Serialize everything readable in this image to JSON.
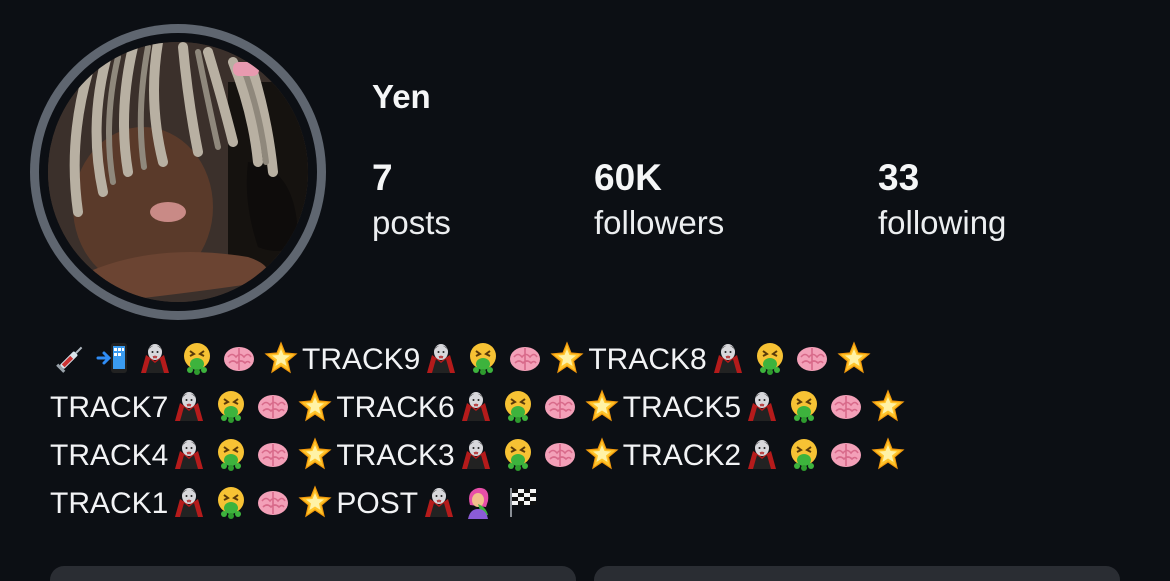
{
  "profile": {
    "username": "Yen",
    "stats": {
      "posts": {
        "value": "7",
        "label": "posts"
      },
      "followers": {
        "value": "60K",
        "label": "followers"
      },
      "following": {
        "value": "33",
        "label": "following"
      }
    }
  },
  "bio": {
    "lines": [
      [
        {
          "t": "e",
          "icon": "syringe-icon"
        },
        {
          "t": "e",
          "icon": "phone-arrow-icon"
        },
        {
          "t": "e",
          "icon": "vampire-icon"
        },
        {
          "t": "e",
          "icon": "vomit-face-icon"
        },
        {
          "t": "e",
          "icon": "brain-icon"
        },
        {
          "t": "e",
          "icon": "star-icon"
        },
        {
          "t": "x",
          "text": "TRACK9"
        },
        {
          "t": "e",
          "icon": "vampire-icon"
        },
        {
          "t": "e",
          "icon": "vomit-face-icon"
        },
        {
          "t": "e",
          "icon": "brain-icon"
        },
        {
          "t": "e",
          "icon": "star-icon"
        },
        {
          "t": "x",
          "text": "TRACK8"
        },
        {
          "t": "e",
          "icon": "vampire-icon"
        },
        {
          "t": "e",
          "icon": "vomit-face-icon"
        },
        {
          "t": "e",
          "icon": "brain-icon"
        },
        {
          "t": "e",
          "icon": "star-icon"
        }
      ],
      [
        {
          "t": "x",
          "text": "TRACK7"
        },
        {
          "t": "e",
          "icon": "vampire-icon"
        },
        {
          "t": "e",
          "icon": "vomit-face-icon"
        },
        {
          "t": "e",
          "icon": "brain-icon"
        },
        {
          "t": "e",
          "icon": "star-icon"
        },
        {
          "t": "x",
          "text": "TRACK6"
        },
        {
          "t": "e",
          "icon": "vampire-icon"
        },
        {
          "t": "e",
          "icon": "vomit-face-icon"
        },
        {
          "t": "e",
          "icon": "brain-icon"
        },
        {
          "t": "e",
          "icon": "star-icon"
        },
        {
          "t": "x",
          "text": "TRACK5"
        },
        {
          "t": "e",
          "icon": "vampire-icon"
        },
        {
          "t": "e",
          "icon": "vomit-face-icon"
        },
        {
          "t": "e",
          "icon": "brain-icon"
        },
        {
          "t": "e",
          "icon": "star-icon"
        }
      ],
      [
        {
          "t": "x",
          "text": "TRACK4"
        },
        {
          "t": "e",
          "icon": "vampire-icon"
        },
        {
          "t": "e",
          "icon": "vomit-face-icon"
        },
        {
          "t": "e",
          "icon": "brain-icon"
        },
        {
          "t": "e",
          "icon": "star-icon"
        },
        {
          "t": "x",
          "text": "TRACK3"
        },
        {
          "t": "e",
          "icon": "vampire-icon"
        },
        {
          "t": "e",
          "icon": "vomit-face-icon"
        },
        {
          "t": "e",
          "icon": "brain-icon"
        },
        {
          "t": "e",
          "icon": "star-icon"
        },
        {
          "t": "x",
          "text": "TRACK2"
        },
        {
          "t": "e",
          "icon": "vampire-icon"
        },
        {
          "t": "e",
          "icon": "vomit-face-icon"
        },
        {
          "t": "e",
          "icon": "brain-icon"
        },
        {
          "t": "e",
          "icon": "star-icon"
        }
      ],
      [
        {
          "t": "x",
          "text": "TRACK1"
        },
        {
          "t": "e",
          "icon": "vampire-icon"
        },
        {
          "t": "e",
          "icon": "vomit-face-icon"
        },
        {
          "t": "e",
          "icon": "brain-icon"
        },
        {
          "t": "e",
          "icon": "star-icon"
        },
        {
          "t": "x",
          "text": "POST"
        },
        {
          "t": "e",
          "icon": "vampire-icon"
        },
        {
          "t": "e",
          "icon": "woman-vomiting-icon"
        },
        {
          "t": "e",
          "icon": "checkered-flag-icon"
        }
      ]
    ]
  },
  "colors": {
    "background": "#0c0f14",
    "text": "#f2f3f5",
    "avatar_ring": "#5f6670",
    "button_bg": "#2a2d33"
  }
}
